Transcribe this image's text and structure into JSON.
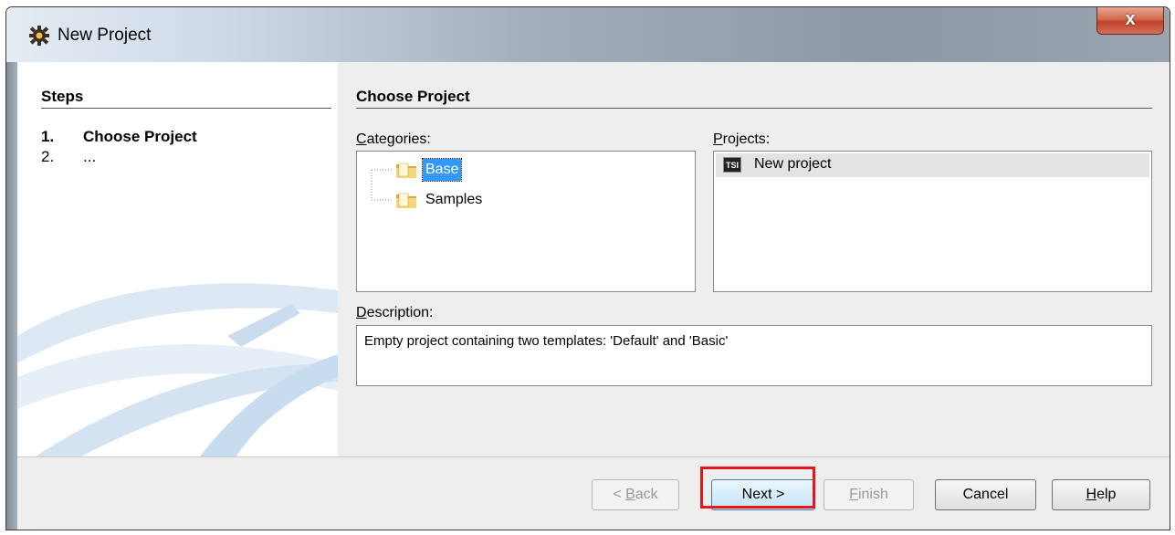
{
  "window": {
    "title": "New Project",
    "close_label": "x"
  },
  "steps": {
    "heading": "Steps",
    "items": [
      {
        "num": "1.",
        "label": "Choose Project"
      },
      {
        "num": "2.",
        "label": "..."
      }
    ]
  },
  "main": {
    "heading": "Choose Project",
    "categories": {
      "label_first": "C",
      "label_rest": "ategories:",
      "items": [
        "Base",
        "Samples"
      ],
      "selected": "Base"
    },
    "projects": {
      "label_first": "P",
      "label_rest": "rojects:",
      "items": [
        {
          "icon_text": "TSI",
          "label": "New project"
        }
      ]
    },
    "description": {
      "label_first": "D",
      "label_rest": "escription:",
      "text": "Empty project containing two templates: 'Default' and 'Basic'"
    }
  },
  "buttons": {
    "back": {
      "prefix": "< ",
      "mnemonic": "B",
      "rest": "ack"
    },
    "next": {
      "label": "Next >"
    },
    "finish": {
      "mnemonic": "F",
      "rest": "inish"
    },
    "cancel": {
      "label": "Cancel"
    },
    "help": {
      "mnemonic": "H",
      "rest": "elp"
    }
  },
  "colors": {
    "selection": "#3399ff",
    "highlight_box": "#e8141b"
  }
}
